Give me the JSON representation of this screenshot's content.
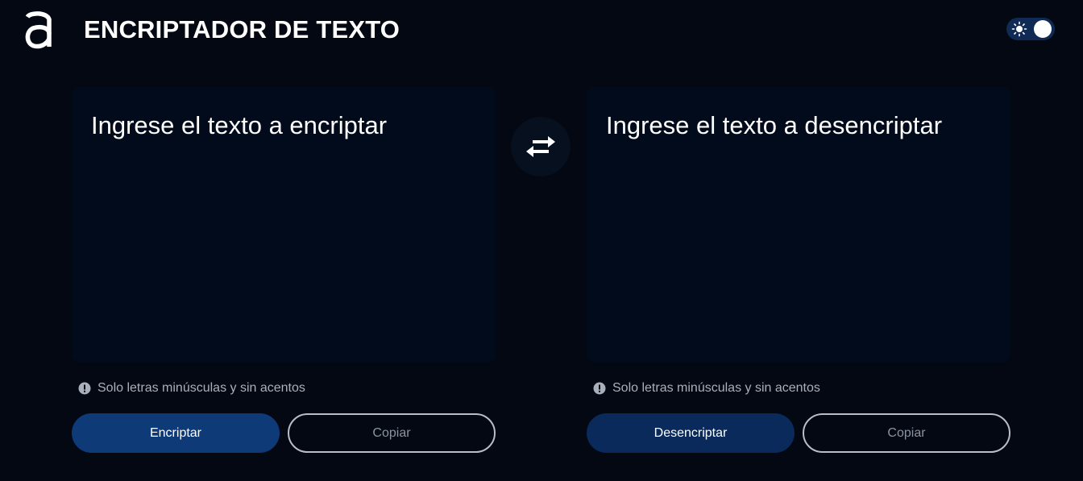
{
  "header": {
    "title": "ENCRIPTADOR DE TEXTO",
    "logo_icon": "alura-a-logo-icon",
    "theme_toggle_icon": "sun-icon"
  },
  "encrypt_panel": {
    "placeholder": "Ingrese el texto a encriptar",
    "value": "",
    "hint": "Solo letras minúsculas y sin acentos",
    "action_label": "Encriptar",
    "copy_label": "Copiar"
  },
  "decrypt_panel": {
    "placeholder": "Ingrese el texto a desencriptar",
    "value": "",
    "hint": "Solo letras minúsculas y sin acentos",
    "action_label": "Desencriptar",
    "copy_label": "Copiar"
  },
  "swap_icon": "swap-arrows-icon",
  "colors": {
    "background": "#030812",
    "panel": "#020b1c",
    "primary_button": "#0f3a78",
    "secondary_primary_button": "#0a2a5c",
    "toggle_track": "#0f2a55",
    "hint_text": "#aab0bb"
  }
}
